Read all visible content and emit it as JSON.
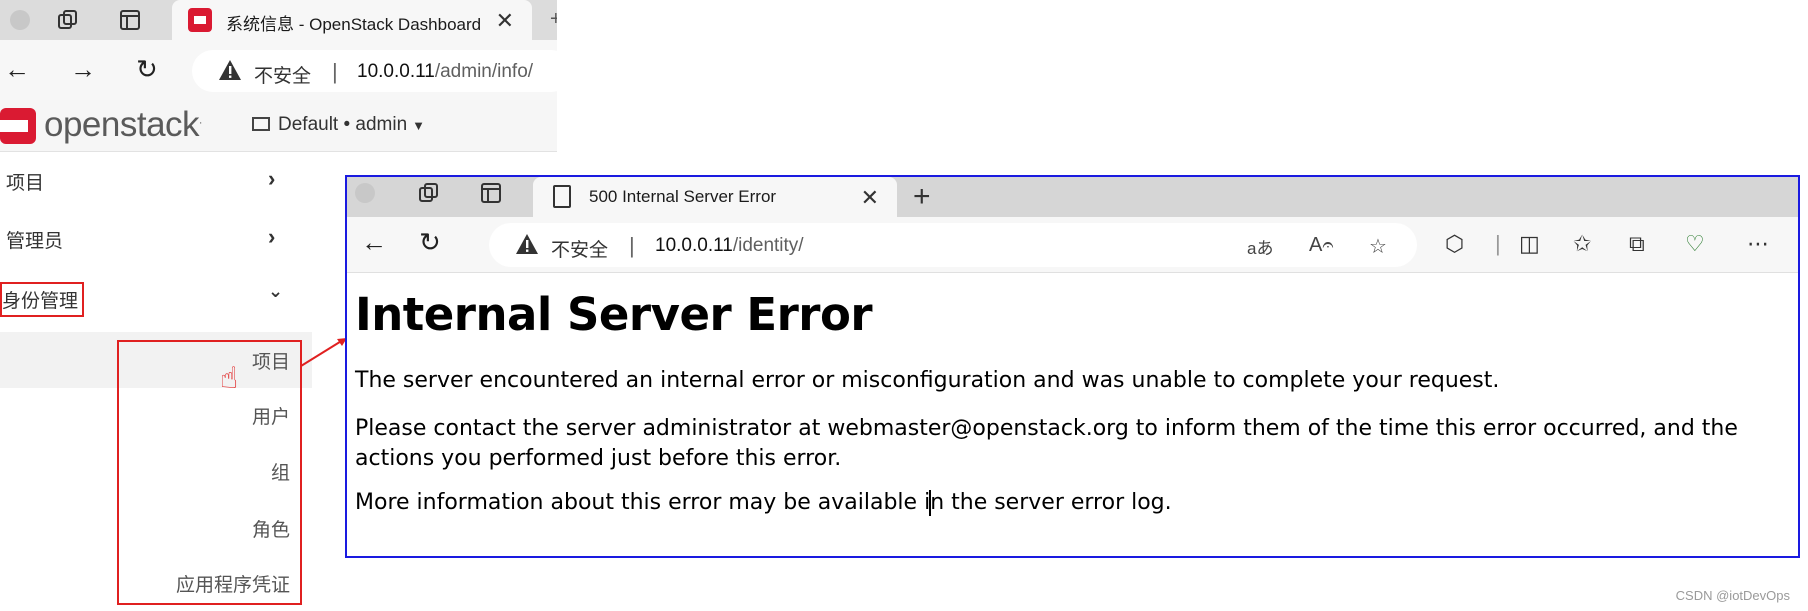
{
  "left_window": {
    "tab_title": "系统信息 - OpenStack Dashboard",
    "address": {
      "insecure_label": "不安全",
      "host": "10.0.0.11",
      "path": "/admin/info/"
    },
    "header": {
      "logo_text": "openstack",
      "project_selector": "Default • admin"
    },
    "sidebar": {
      "items": [
        {
          "label": "项目",
          "expanded": false
        },
        {
          "label": "管理员",
          "expanded": false
        },
        {
          "label": "身份管理",
          "expanded": true
        }
      ],
      "sub_items": [
        {
          "label": "项目",
          "highlighted": true
        },
        {
          "label": "用户"
        },
        {
          "label": "组"
        },
        {
          "label": "角色"
        },
        {
          "label": "应用程序凭证"
        }
      ]
    }
  },
  "right_window": {
    "tab_title": "500 Internal Server Error",
    "address": {
      "insecure_label": "不安全",
      "host": "10.0.0.11",
      "path": "/identity/"
    },
    "content": {
      "heading": "Internal Server Error",
      "paragraph1": "The server encountered an internal error or misconfiguration and was unable to complete your request.",
      "paragraph2": "Please contact the server administrator at webmaster@openstack.org to inform them of the time this error occurred, and the actions you performed just before this error.",
      "paragraph3_before_cursor": "More information about this error may be available i",
      "paragraph3_after_cursor": "n the server error log."
    }
  },
  "annotation_colors": {
    "highlight_box": "#e02020",
    "error_window_border": "#1a1ae0"
  },
  "watermark": "CSDN @iotDevOps"
}
